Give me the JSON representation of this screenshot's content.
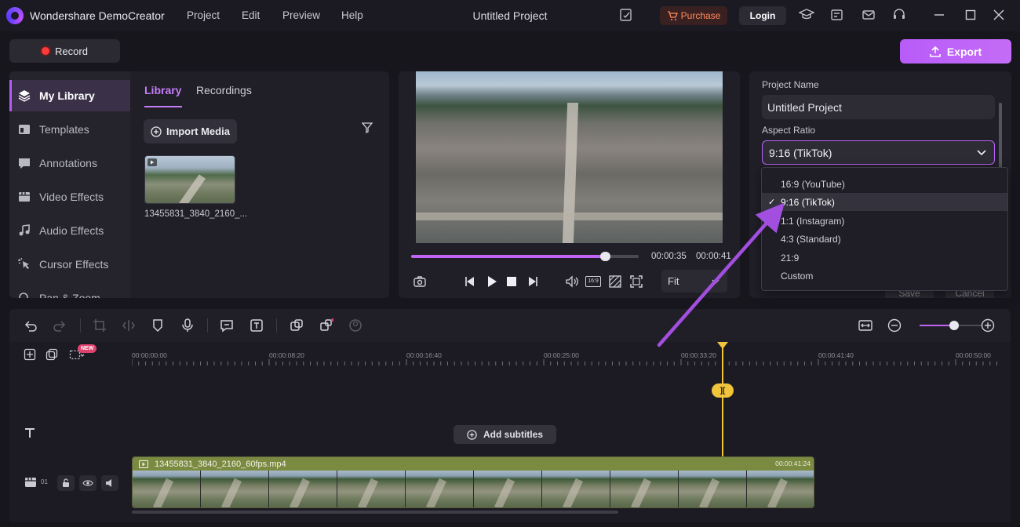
{
  "app": {
    "title": "Wondershare DemoCreator",
    "menu": [
      "Project",
      "Edit",
      "Preview",
      "Help"
    ],
    "project_title": "Untitled Project",
    "purchase_label": "Purchase",
    "login_label": "Login"
  },
  "toolbar": {
    "record_label": "Record",
    "export_label": "Export"
  },
  "sidebar": {
    "items": [
      {
        "label": "My Library",
        "icon": "layers-icon"
      },
      {
        "label": "Templates",
        "icon": "template-icon"
      },
      {
        "label": "Annotations",
        "icon": "annotation-icon"
      },
      {
        "label": "Video Effects",
        "icon": "film-icon"
      },
      {
        "label": "Audio Effects",
        "icon": "music-icon"
      },
      {
        "label": "Cursor Effects",
        "icon": "cursor-icon"
      },
      {
        "label": "Pan & Zoom",
        "icon": "zoom-icon"
      }
    ]
  },
  "library": {
    "tabs": [
      "Library",
      "Recordings"
    ],
    "import_label": "Import Media",
    "media": [
      {
        "name": "13455831_3840_2160_..."
      }
    ]
  },
  "preview": {
    "current_time": "00:00:35",
    "total_time": "00:00:41",
    "progress": 0.85,
    "fit_label": "Fit",
    "aspect_badge": "16:9"
  },
  "settings": {
    "project_name_label": "Project Name",
    "project_name_value": "Untitled Project",
    "aspect_ratio_label": "Aspect Ratio",
    "aspect_ratio_value": "9:16 (TikTok)",
    "save_label": "Save",
    "cancel_label": "Cancel"
  },
  "aspect_dropdown": {
    "options": [
      "16:9 (YouTube)",
      "9:16 (TikTok)",
      "1:1 (Instagram)",
      "4:3 (Standard)",
      "21:9",
      "Custom"
    ],
    "selected": "9:16 (TikTok)"
  },
  "timeline": {
    "ruler_labels": [
      "00:00:00:00",
      "00:00:08:20",
      "00:00:16:40",
      "00:00:25:00",
      "00:00:33:20",
      "00:00:41:40",
      "00:00:50:00"
    ],
    "new_badge": "NEW",
    "add_subtitles_label": "Add subtitles",
    "track_number": "01",
    "clip": {
      "name": "13455831_3840_2160_60fps.mp4",
      "duration": "00:00:41:24"
    },
    "zoom_level": 0.55
  },
  "colors": {
    "accent": "#c064f5",
    "playhead": "#f1c43b",
    "clip_header": "#7b8a41",
    "purchase_text": "#ff8a5c"
  }
}
